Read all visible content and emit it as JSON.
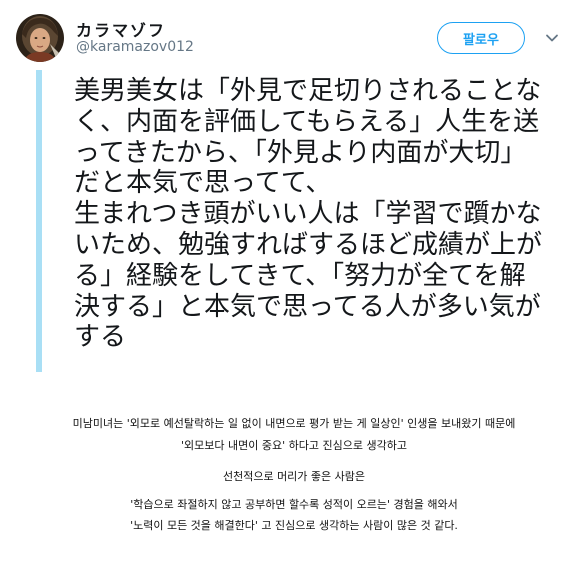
{
  "tweet": {
    "display_name": "カラマゾフ",
    "handle": "@karamazov012",
    "follow_label": "팔로우",
    "avatar_icon": "profile-avatar",
    "menu_icon": "chevron-down-icon",
    "accent_color": "#1da1f2",
    "thread_line_color": "#a9dff5",
    "lines": [
      "美男美女は「外見で足切りされることな",
      "く、内面を評価してもらえる」人生を送",
      "ってきたから、「外見より内面が大切」",
      "だと本気で思ってて、",
      "生まれつき頭がいい人は「学習で躓かな",
      "いため、勉強すればするほど成績が上が",
      "る」経験をしてきて、「努力が全てを解",
      "決する」と本気で思ってる人が多い気が",
      "する"
    ]
  },
  "caption": {
    "lines": [
      "미남미녀는 '외모로 예선탈락하는 일 없이 내면으로 평가 받는 게 일상인' 인생을 보내왔기 때문에",
      "'외모보다 내면이 중요' 하다고 진심으로 생각하고",
      "",
      "선천적으로 머리가 좋은 사람은",
      "'학습으로 좌절하지 않고 공부하면 할수록 성적이 오르는' 경험을 해와서",
      "'노력이 모든 것을 해결한다' 고 진심으로 생각하는 사람이 많은 것 같다."
    ]
  }
}
